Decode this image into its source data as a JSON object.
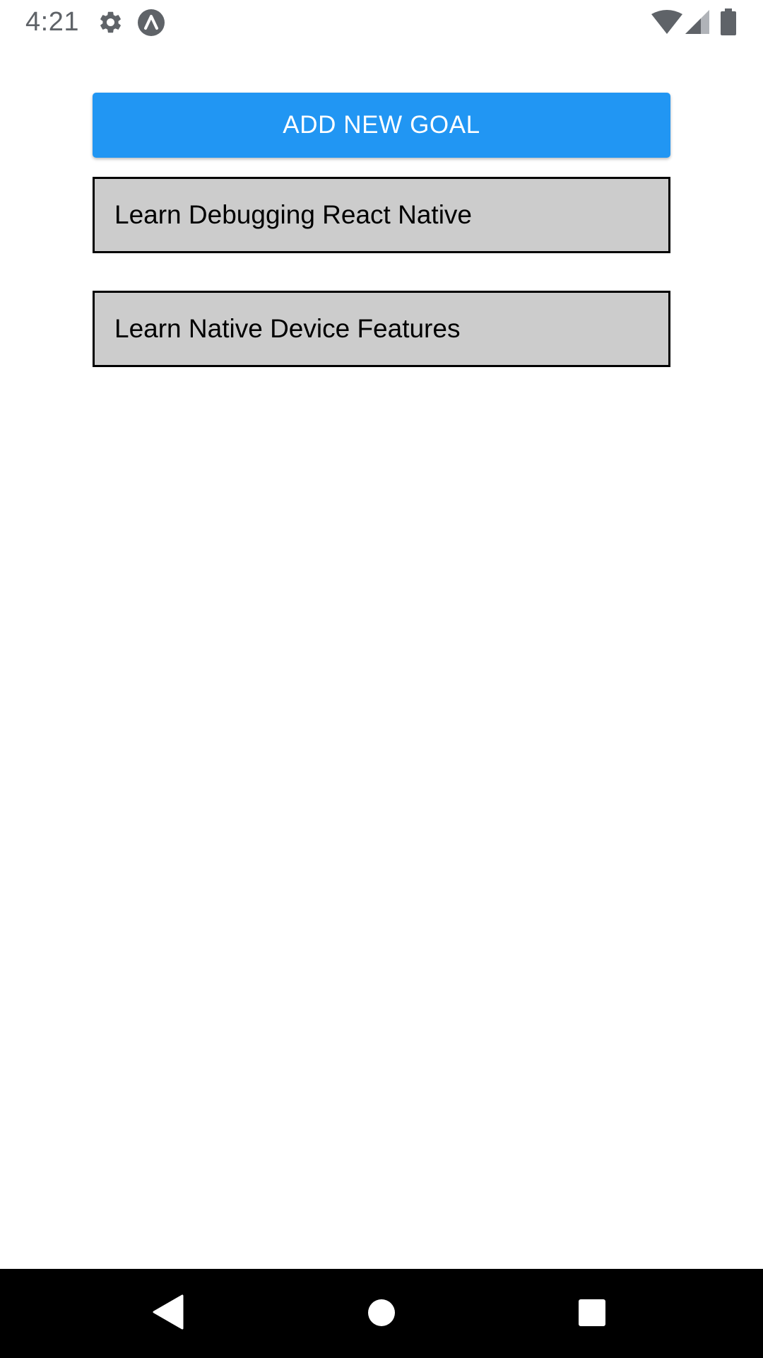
{
  "status_bar": {
    "time": "4:21",
    "icons": [
      "gear-icon",
      "expo-icon",
      "wifi-icon",
      "cell-signal-icon",
      "battery-icon"
    ],
    "icon_color": "#5f6368"
  },
  "main": {
    "add_goal_button_label": "ADD NEW GOAL",
    "button_color": "#2196f3",
    "goals": [
      {
        "text": "Learn Debugging React Native"
      },
      {
        "text": "Learn Native Device Features"
      }
    ],
    "goal_background": "#cccccc",
    "goal_border": "#000000"
  },
  "nav_bar": {
    "buttons": [
      "back-icon",
      "home-icon",
      "recents-icon"
    ],
    "background": "#000000",
    "icon_color": "#ffffff"
  }
}
